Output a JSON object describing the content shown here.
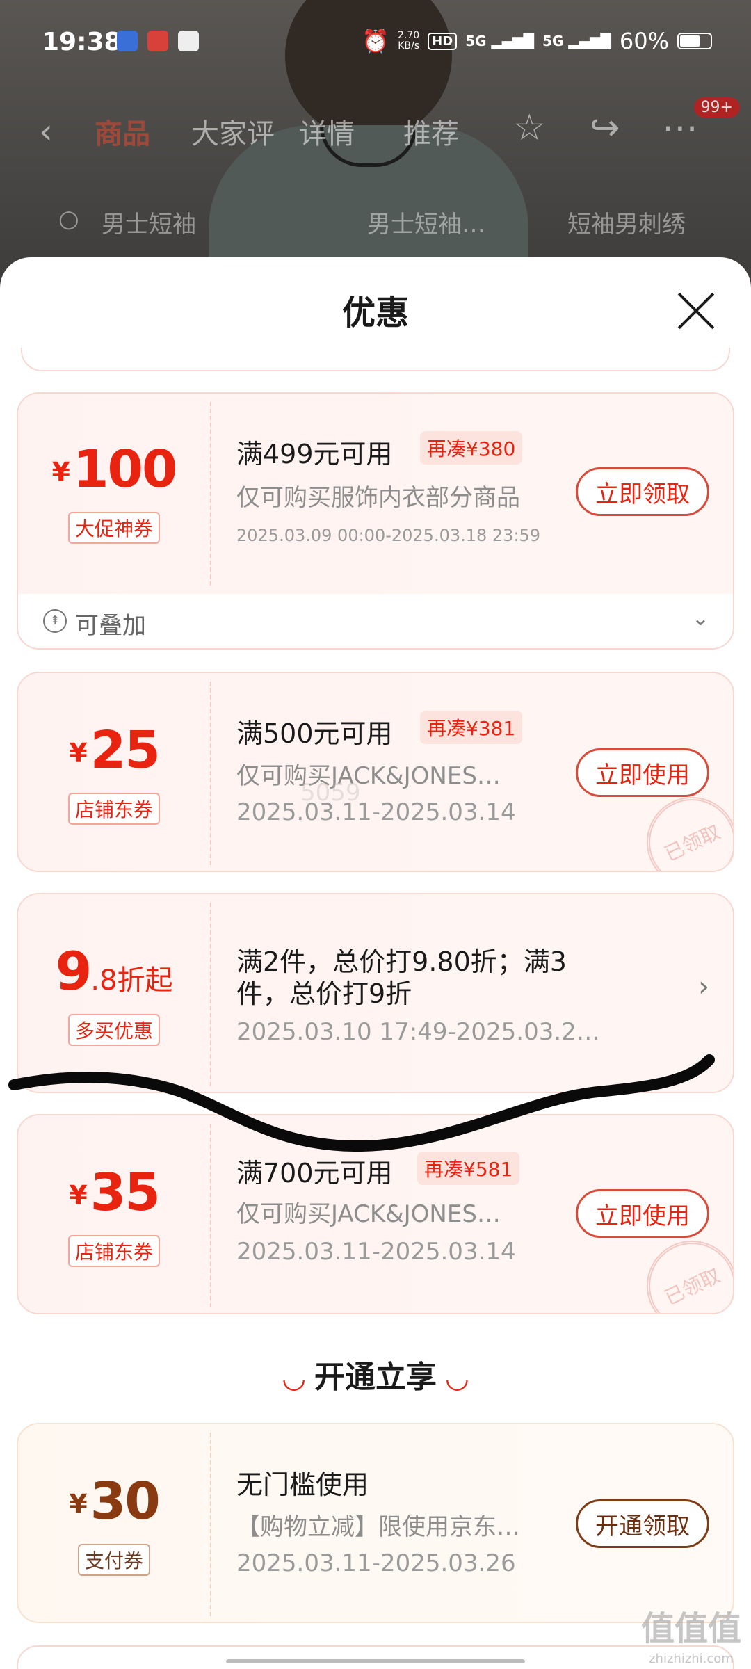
{
  "status_bar": {
    "time": "19:38",
    "net_speed": "2.70\nKB/s",
    "hd_tag": "HD",
    "sim1": "5G",
    "sim2": "5G",
    "battery": "60%"
  },
  "nav": {
    "tabs": [
      "商品",
      "大家评",
      "详情",
      "推荐"
    ],
    "cart_badge": "99+"
  },
  "search_row": {
    "query": "男士短袖",
    "chip1": "男士短袖…",
    "chip2": "短袖男刺绣"
  },
  "sheet": {
    "title": "优惠"
  },
  "coupons": [
    {
      "symbol": "¥",
      "amount": "100",
      "type": "大促神券",
      "title": "满499元可用",
      "gap": "再凑¥380",
      "desc": "仅可购买服饰内衣部分商品",
      "date": "2025.03.09 00:00-2025.03.18 23:59",
      "button": "立即领取",
      "stack_label": "可叠加"
    },
    {
      "symbol": "¥",
      "amount": "25",
      "type": "店铺东券",
      "title": "满500元可用",
      "gap": "再凑¥381",
      "desc": "仅可购买JACK&JONES…",
      "date": "2025.03.11-2025.03.14",
      "button": "立即使用",
      "stamp": "已领取"
    },
    {
      "amount_big": "9",
      "amount_small": ".8折起",
      "type": "多买优惠",
      "title_line1": "满2件，总价打9.80折；满3",
      "title_line2": "件，总价打9折",
      "date": "2025.03.10 17:49-2025.03.2…"
    },
    {
      "symbol": "¥",
      "amount": "35",
      "type": "店铺东券",
      "title": "满700元可用",
      "gap": "再凑¥581",
      "desc": "仅可购买JACK&JONES…",
      "date": "2025.03.11-2025.03.14",
      "button": "立即使用",
      "stamp": "已领取"
    }
  ],
  "vip_section": {
    "heading": "开通立享",
    "coupon": {
      "symbol": "¥",
      "amount": "30",
      "type": "支付券",
      "title": "无门槛使用",
      "desc": "【购物立减】限使用京东…",
      "date": "2025.03.11-2025.03.26",
      "button": "开通领取"
    }
  },
  "watermark": {
    "main": "值值值",
    "sub": "zhizhizhi.com",
    "center": "5059"
  },
  "colors": {
    "accent_red": "#e8230f",
    "vip_brown": "#7d3d17",
    "card_bg": "#fff3f1"
  }
}
